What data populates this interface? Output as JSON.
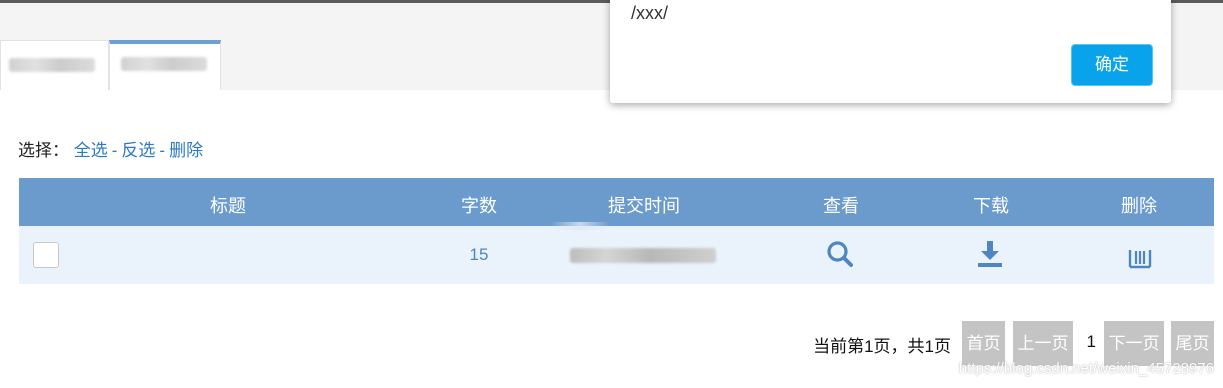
{
  "select": {
    "label": "选择：",
    "select_all": "全选",
    "invert": "反选",
    "delete": "删除",
    "separator": "-"
  },
  "table": {
    "headers": [
      "标题",
      "字数",
      "提交时间",
      "查看",
      "下载",
      "删除"
    ],
    "rows": [
      {
        "title": "",
        "count": "15"
      }
    ]
  },
  "pager": {
    "info": "当前第1页，共1页",
    "first": "首页",
    "prev": "上一页",
    "current": "1",
    "next": "下一页",
    "last": "尾页"
  },
  "dialog": {
    "message": "/xxx/",
    "ok": "确定"
  },
  "watermark": "https://blog.csdn.net/weixin_45728976",
  "icons": {
    "view": "search-icon",
    "download": "download-icon",
    "delete": "trash-icon"
  },
  "colors": {
    "header_bg": "#6b9bcd",
    "row_bg": "#eaf3fb",
    "link": "#2c79c4",
    "icon": "#4d86c0",
    "primary_button": "#09a3ec",
    "pager_button": "#c4c4c4"
  }
}
